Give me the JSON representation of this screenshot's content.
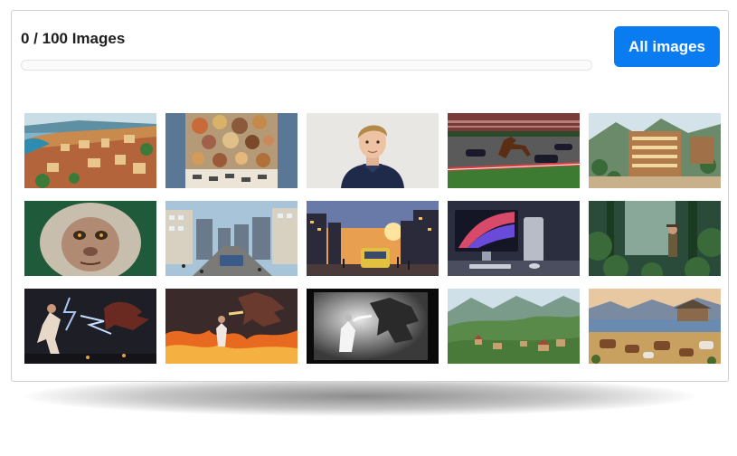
{
  "header": {
    "counter_text": "0 / 100 Images",
    "progress_fraction": 0
  },
  "buttons": {
    "all_images_label": "All images"
  },
  "colors": {
    "accent": "#0a7cf2",
    "text": "#1e1e1e",
    "card_border": "#cfcfcf"
  },
  "gallery": {
    "images": [
      {
        "subject": "coastal-town"
      },
      {
        "subject": "hot-air-balloons"
      },
      {
        "subject": "young-man-portrait"
      },
      {
        "subject": "horse-race-track"
      },
      {
        "subject": "mountain-resort"
      },
      {
        "subject": "monkey-face"
      },
      {
        "subject": "city-street"
      },
      {
        "subject": "sunset-city-bus"
      },
      {
        "subject": "computer-desk"
      },
      {
        "subject": "jungle-explorer"
      },
      {
        "subject": "lightning-dragon-fight"
      },
      {
        "subject": "fire-dragon"
      },
      {
        "subject": "monochrome-dragon"
      },
      {
        "subject": "green-valley-village"
      },
      {
        "subject": "lakeside-cattle"
      }
    ]
  }
}
